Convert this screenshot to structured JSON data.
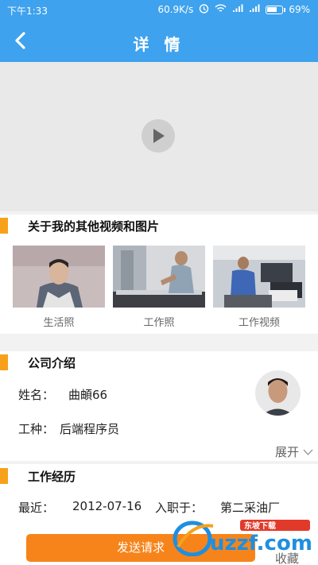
{
  "status_bar": {
    "time": "下午1:33",
    "speed": "60.9K/s",
    "battery": "69%",
    "battery_level": 0.69
  },
  "nav": {
    "title": "详 情"
  },
  "other_media": {
    "heading": "关于我的其他视频和图片",
    "items": [
      {
        "label": "生活照"
      },
      {
        "label": "工作照"
      },
      {
        "label": "工作视频"
      }
    ]
  },
  "company": {
    "heading": "公司介绍",
    "name_label": "姓名：",
    "name_value": "曲頔66",
    "job_label": "工种：",
    "job_value": "后端程序员",
    "expand_label": "展开"
  },
  "experience": {
    "heading": "工作经历",
    "recent_label": "最近：",
    "recent_date": "2012-07-16",
    "joined_label": "入职于：",
    "company": "第二采油厂"
  },
  "actions": {
    "send_label": "发送请求",
    "favorite_label": "收藏"
  },
  "watermark": {
    "brand": "uzzf.com",
    "tagline": "东坡下载"
  },
  "colors": {
    "header": "#3ea2ee",
    "accent": "#f7a11a",
    "button": "#f7841a"
  }
}
